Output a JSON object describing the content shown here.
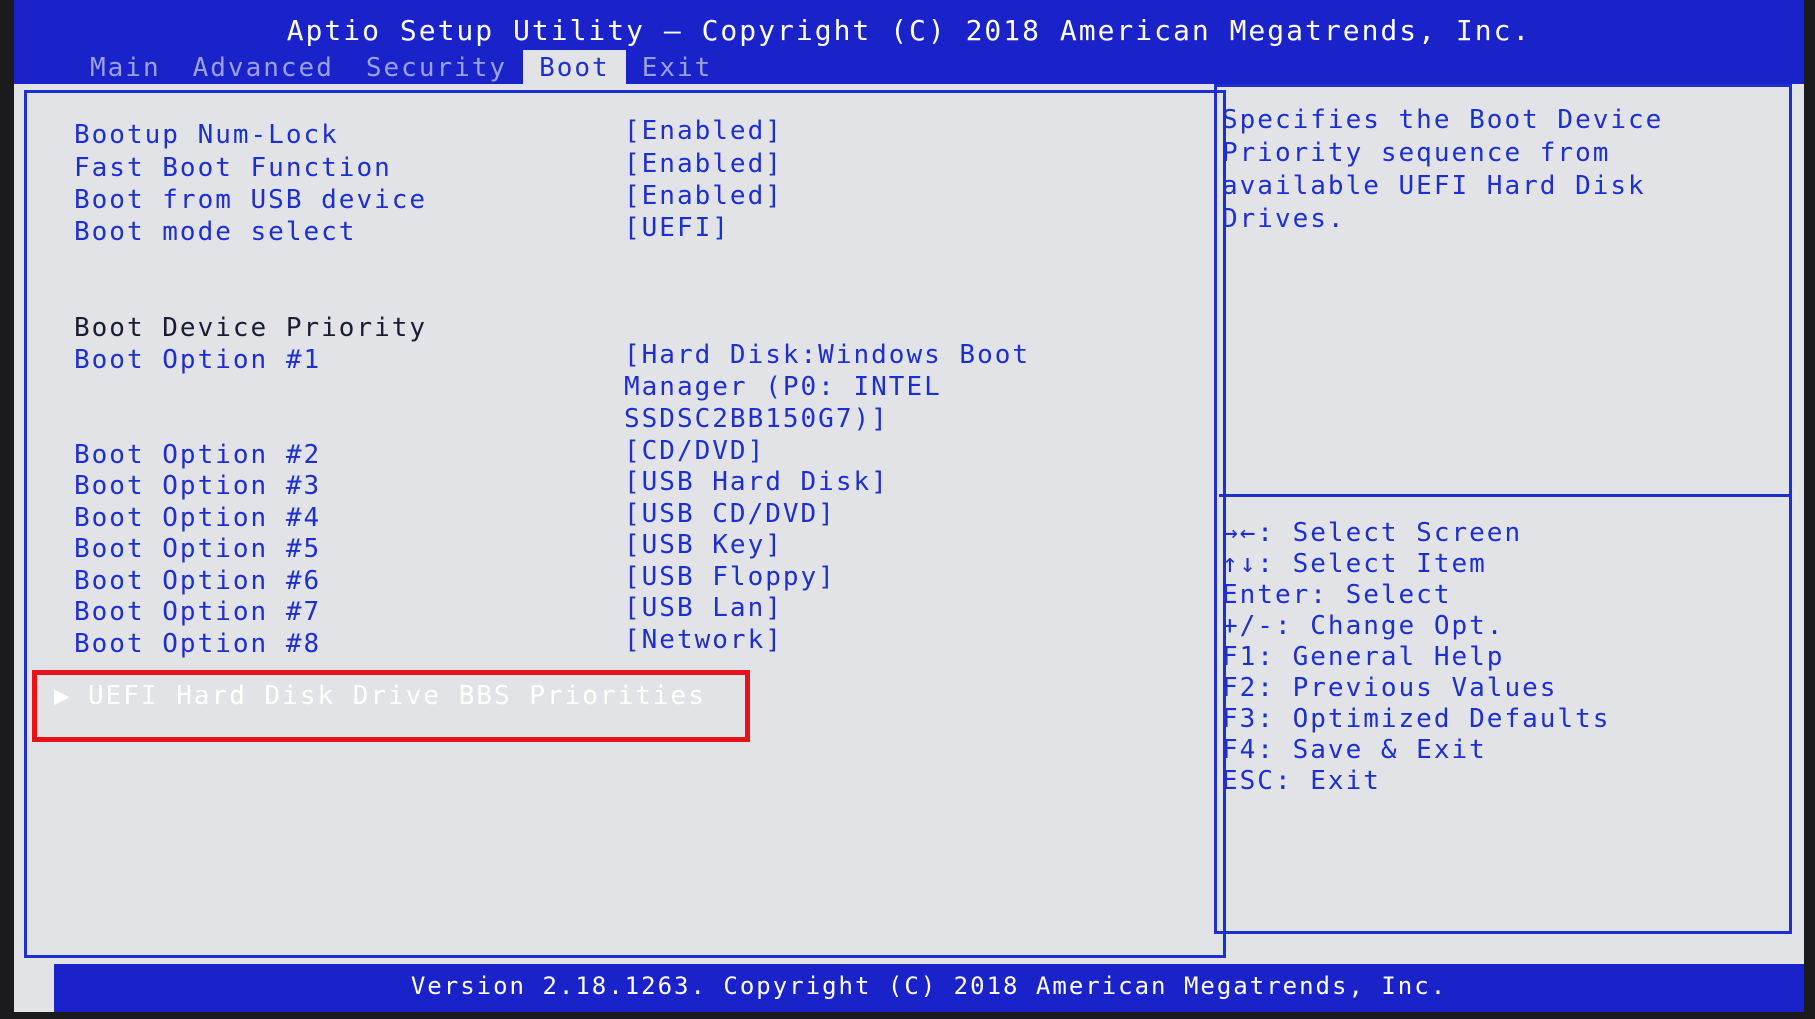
{
  "header": {
    "title": "Aptio Setup Utility – Copyright (C) 2018 American Megatrends, Inc.",
    "tabs": [
      {
        "label": "Main"
      },
      {
        "label": "Advanced"
      },
      {
        "label": "Security"
      },
      {
        "label": "Boot"
      },
      {
        "label": "Exit"
      }
    ],
    "active_tab": "Boot"
  },
  "settings": [
    {
      "label": "Bootup Num-Lock",
      "value": "[Enabled]"
    },
    {
      "label": "Fast Boot Function",
      "value": "[Enabled]"
    },
    {
      "label": "Boot from USB device",
      "value": "[Enabled]"
    },
    {
      "label": "Boot mode select",
      "value": "[UEFI]"
    }
  ],
  "boot_priority": {
    "heading": "Boot Device Priority",
    "option1": {
      "label": "Boot Option #1",
      "value_lines": [
        "[Hard Disk:Windows Boot",
        "Manager (P0: INTEL",
        "SSDSC2BB150G7)]"
      ]
    },
    "options": [
      {
        "label": "Boot Option #2",
        "value": "[CD/DVD]"
      },
      {
        "label": "Boot Option #3",
        "value": "[USB Hard Disk]"
      },
      {
        "label": "Boot Option #4",
        "value": "[USB CD/DVD]"
      },
      {
        "label": "Boot Option #5",
        "value": "[USB Key]"
      },
      {
        "label": "Boot Option #6",
        "value": "[USB Floppy]"
      },
      {
        "label": "Boot Option #7",
        "value": "[USB Lan]"
      },
      {
        "label": "Boot Option #8",
        "value": "[Network]"
      }
    ]
  },
  "submenu": {
    "arrow": "▶",
    "label": "UEFI Hard Disk Drive BBS Priorities"
  },
  "help": {
    "text": "Specifies the Boot Device\nPriority sequence from\navailable UEFI Hard Disk\nDrives."
  },
  "keys": [
    "→←: Select Screen",
    "↑↓: Select Item",
    "Enter: Select",
    "+/-: Change Opt.",
    "F1: General Help",
    "F2: Previous Values",
    "F3: Optimized Defaults",
    "F4: Save & Exit",
    "ESC: Exit"
  ],
  "footer": {
    "version": "Version 2.18.1263. Copyright (C) 2018 American Megatrends, Inc."
  },
  "colors": {
    "bios_blue": "#1a23c9",
    "panel_bg": "#e1e3e6",
    "text_blue": "#1e2fd0",
    "highlight_red": "#e8121b"
  }
}
